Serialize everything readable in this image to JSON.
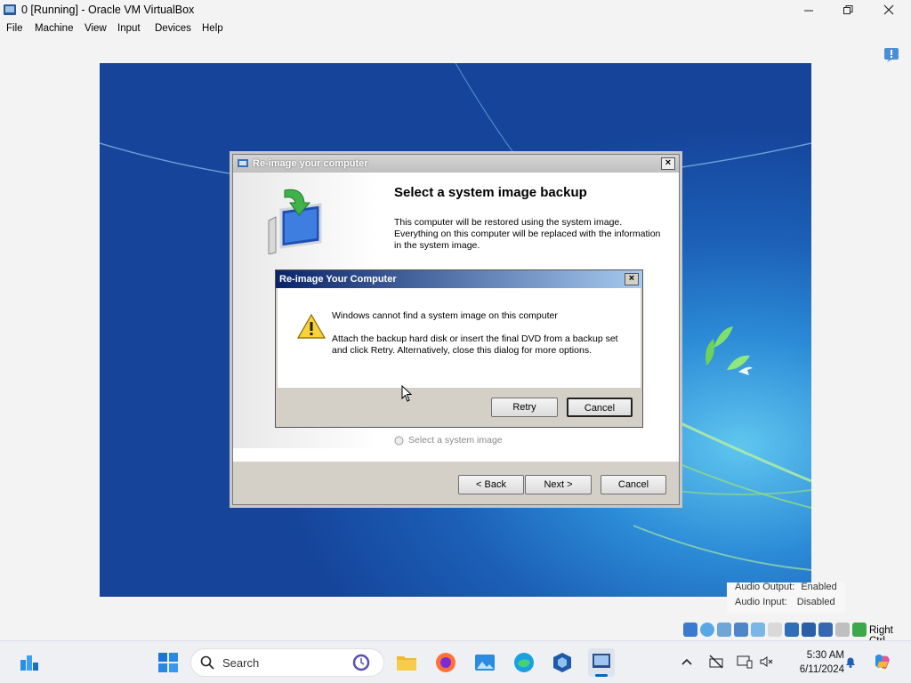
{
  "window": {
    "title": "0 [Running] - Oracle VM VirtualBox",
    "menu": [
      "File",
      "Machine",
      "View",
      "Input",
      "Devices",
      "Help"
    ]
  },
  "wizard": {
    "title": "Re-image your computer",
    "heading": "Select a system image backup",
    "description": "This computer will be restored using the system image. Everything on this computer will be replaced with the information in the system image.",
    "radio_label": "Select a system image",
    "back_label": "< Back",
    "next_label": "Next >",
    "cancel_label": "Cancel"
  },
  "error_dialog": {
    "title": "Re-image Your Computer",
    "message_title": "Windows cannot find a system image on this computer",
    "message_body": "Attach the backup hard disk or insert the final DVD from a backup set and click Retry. Alternatively, close this dialog for more options.",
    "retry_label": "Retry",
    "cancel_label": "Cancel"
  },
  "status_popup": {
    "audio_output_label": "Audio Output:",
    "audio_output_value": "Enabled",
    "audio_input_label": "Audio Input:",
    "audio_input_value": "Disabled"
  },
  "statusbar": {
    "host_key": "Right Ctrl",
    "icons": [
      "hard-disk-icon",
      "optical-drive-icon",
      "audio-icon",
      "network-icon",
      "usb-icon",
      "shared-folders-icon",
      "display-icon",
      "recording-icon",
      "cpu-icon",
      "mouse-integration-icon",
      "keyboard-icon"
    ]
  },
  "taskbar": {
    "search_placeholder": "Search",
    "time": "5:30 AM",
    "date": "6/11/2024",
    "apps": [
      "widgets-icon",
      "start-icon",
      "file-explorer-icon",
      "firefox-icon",
      "photos-icon",
      "edge-icon",
      "virtualbox-icon",
      "vm-app-icon"
    ]
  },
  "colors": {
    "error_title_start": "#0a246a",
    "error_title_end": "#a6caf0",
    "desktop_blue": "#1c5fb7",
    "taskbar_bg": "#eef0f4"
  }
}
